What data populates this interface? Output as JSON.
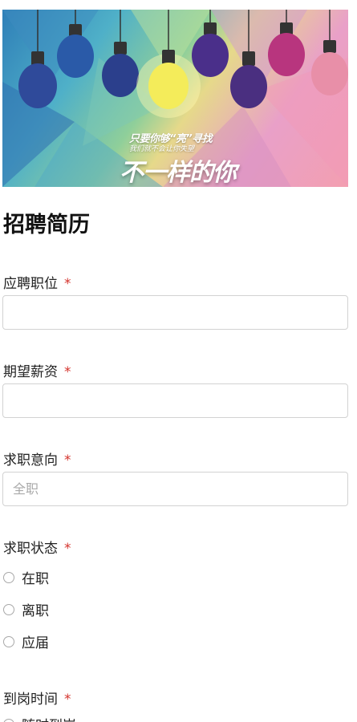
{
  "banner": {
    "line1": "只要你够“亮”寻找",
    "line1_small": "我们就不会让你失望",
    "line2": "不一样的你",
    "bulb_colors": [
      "#2f4a9a",
      "#2a5aa8",
      "#2b3f8c",
      "#f4ec5a",
      "#4a2f8a",
      "#4a2f80",
      "#b8357e",
      "#e88fa8"
    ]
  },
  "form": {
    "title": "招聘简历",
    "required_mark": "*",
    "fields": {
      "position": {
        "label": "应聘职位",
        "value": "",
        "placeholder": ""
      },
      "salary": {
        "label": "期望薪资",
        "value": "",
        "placeholder": ""
      },
      "intention": {
        "label": "求职意向",
        "value": "",
        "placeholder": "全职"
      },
      "status": {
        "label": "求职状态",
        "options": [
          "在职",
          "离职",
          "应届"
        ]
      },
      "arrival": {
        "label": "到岗时间",
        "options": [
          "随时到岗"
        ]
      }
    }
  },
  "colors": {
    "required": "#d4332c",
    "border": "#d2d2d2"
  }
}
